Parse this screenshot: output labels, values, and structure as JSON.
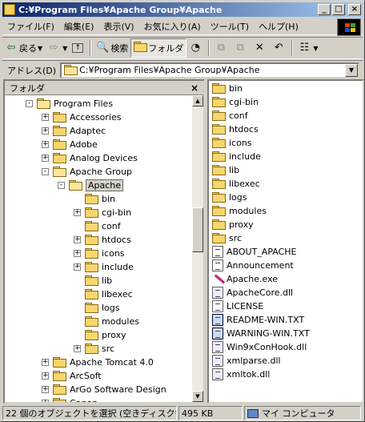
{
  "window": {
    "title": "C:¥Program Files¥Apache Group¥Apache",
    "minimize": "_",
    "maximize": "□",
    "close": "×"
  },
  "menu": [
    "ファイル(F)",
    "編集(E)",
    "表示(V)",
    "お気に入り(A)",
    "ツール(T)",
    "ヘルプ(H)"
  ],
  "toolbar": {
    "back": "戻る",
    "search": "検索",
    "folders": "フォルダ"
  },
  "address": {
    "label": "アドレス(D)",
    "value": "C:¥Program Files¥Apache Group¥Apache"
  },
  "folder_pane": {
    "title": "フォルダ",
    "close": "×",
    "tree": [
      {
        "label": "Program Files",
        "level": 0,
        "expander": "-",
        "open": true
      },
      {
        "label": "Accessories",
        "level": 1,
        "expander": "+"
      },
      {
        "label": "Adaptec",
        "level": 1,
        "expander": "+"
      },
      {
        "label": "Adobe",
        "level": 1,
        "expander": "+"
      },
      {
        "label": "Analog Devices",
        "level": 1,
        "expander": "+"
      },
      {
        "label": "Apache Group",
        "level": 1,
        "expander": "-",
        "open": true
      },
      {
        "label": "Apache",
        "level": 2,
        "expander": "-",
        "open": true,
        "selected": true
      },
      {
        "label": "bin",
        "level": 3,
        "expander": ""
      },
      {
        "label": "cgi-bin",
        "level": 3,
        "expander": "+"
      },
      {
        "label": "conf",
        "level": 3,
        "expander": ""
      },
      {
        "label": "htdocs",
        "level": 3,
        "expander": "+"
      },
      {
        "label": "icons",
        "level": 3,
        "expander": "+"
      },
      {
        "label": "include",
        "level": 3,
        "expander": "+"
      },
      {
        "label": "lib",
        "level": 3,
        "expander": ""
      },
      {
        "label": "libexec",
        "level": 3,
        "expander": ""
      },
      {
        "label": "logs",
        "level": 3,
        "expander": ""
      },
      {
        "label": "modules",
        "level": 3,
        "expander": ""
      },
      {
        "label": "proxy",
        "level": 3,
        "expander": ""
      },
      {
        "label": "src",
        "level": 3,
        "expander": "+"
      },
      {
        "label": "Apache Tomcat 4.0",
        "level": 1,
        "expander": "+"
      },
      {
        "label": "ArcSoft",
        "level": 1,
        "expander": "+"
      },
      {
        "label": "ArGo Software Design",
        "level": 1,
        "expander": "+"
      },
      {
        "label": "Canon",
        "level": 1,
        "expander": "+"
      }
    ]
  },
  "files": [
    {
      "name": "bin",
      "type": "folder"
    },
    {
      "name": "cgi-bin",
      "type": "folder"
    },
    {
      "name": "conf",
      "type": "folder"
    },
    {
      "name": "htdocs",
      "type": "folder"
    },
    {
      "name": "icons",
      "type": "folder"
    },
    {
      "name": "include",
      "type": "folder"
    },
    {
      "name": "lib",
      "type": "folder"
    },
    {
      "name": "libexec",
      "type": "folder"
    },
    {
      "name": "logs",
      "type": "folder"
    },
    {
      "name": "modules",
      "type": "folder"
    },
    {
      "name": "proxy",
      "type": "folder"
    },
    {
      "name": "src",
      "type": "folder"
    },
    {
      "name": "ABOUT_APACHE",
      "type": "file"
    },
    {
      "name": "Announcement",
      "type": "file"
    },
    {
      "name": "Apache.exe",
      "type": "exe"
    },
    {
      "name": "ApacheCore.dll",
      "type": "dll"
    },
    {
      "name": "LICENSE",
      "type": "file"
    },
    {
      "name": "README-WIN.TXT",
      "type": "txt"
    },
    {
      "name": "WARNING-WIN.TXT",
      "type": "txt"
    },
    {
      "name": "Win9xConHook.dll",
      "type": "dll"
    },
    {
      "name": "xmlparse.dll",
      "type": "dll"
    },
    {
      "name": "xmltok.dll",
      "type": "dll"
    }
  ],
  "status": {
    "objects": "22 個のオブジェクトを選択 (空きディスク領域:",
    "size": "495 KB",
    "location": "マイ コンピュータ"
  }
}
